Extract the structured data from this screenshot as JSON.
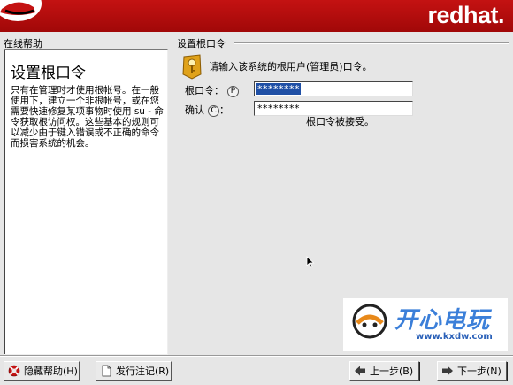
{
  "header": {
    "brand": "redhat."
  },
  "help": {
    "pane_title": "在线帮助",
    "heading": "设置根口令",
    "body": "只有在管理时才使用根帐号。在一般使用下，建立一个非根帐号，或在您需要快速修复某项事物时使用 su - 命令获取根访问权。这些基本的规则可以减少由于键入错误或不正确的命令而损害系统的机会。"
  },
  "form": {
    "section_title": "设置根口令",
    "prompt": "请输入该系统的根用户(管理员)口令。",
    "root_label": "根口令：",
    "root_mnemonic": "P",
    "root_value": "********",
    "confirm_label": "确认",
    "confirm_mnemonic": "C",
    "confirm_colon": "：",
    "confirm_value": "********",
    "status": "根口令被接受。"
  },
  "watermark": {
    "text": "开心电玩",
    "url": "www.kxdw.com"
  },
  "buttons": {
    "hide_help": "隐藏帮助(H)",
    "release_notes": "发行注记(R)",
    "back": "上一步(B)",
    "next": "下一步(N)"
  },
  "icons": {
    "hat": "redhat-logo-icon",
    "key": "key-badge-icon",
    "hide_help": "lifebuoy-icon",
    "release_notes": "document-icon",
    "back": "arrow-left-icon",
    "next": "arrow-right-icon"
  },
  "colors": {
    "brand_red": "#b00e0e",
    "selection": "#1f4fa5"
  }
}
